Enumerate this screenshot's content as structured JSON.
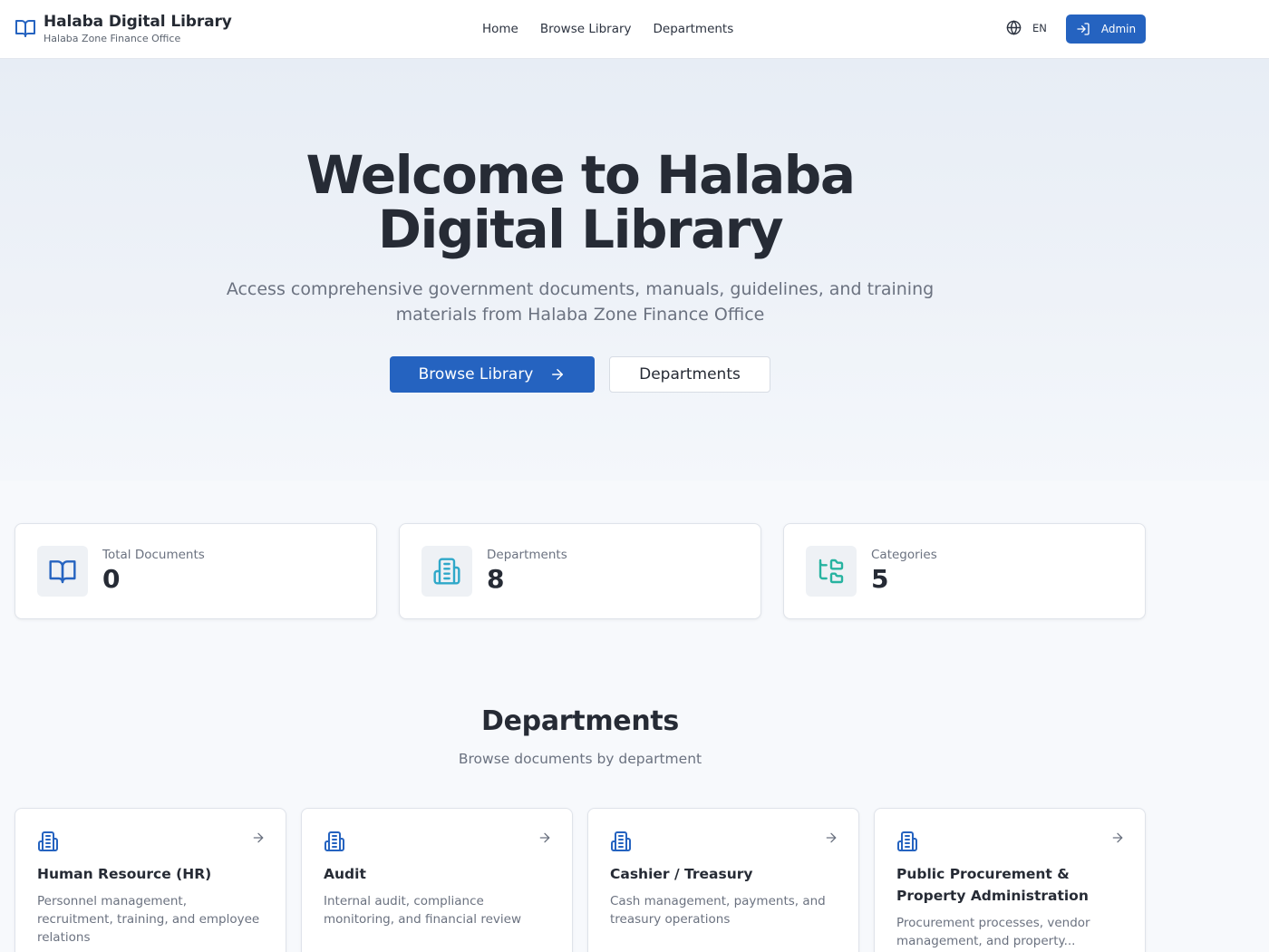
{
  "header": {
    "title": "Halaba Digital Library",
    "subtitle": "Halaba Zone Finance Office",
    "logo_icon": "open-book-icon",
    "nav": [
      {
        "label": "Home"
      },
      {
        "label": "Browse Library"
      },
      {
        "label": "Departments"
      }
    ],
    "language": {
      "icon": "globe-icon",
      "label": "EN"
    },
    "admin_button": {
      "icon": "login-icon",
      "label": "Admin"
    }
  },
  "hero": {
    "title": "Welcome to Halaba Digital Library",
    "description": "Access comprehensive government documents, manuals, guidelines, and training materials from Halaba Zone Finance Office",
    "primary_button": {
      "label": "Browse Library",
      "icon": "arrow-right-icon"
    },
    "secondary_button": {
      "label": "Departments"
    }
  },
  "stats": [
    {
      "label": "Total Documents",
      "value": "0",
      "icon": "book-icon",
      "color": "#2563c0"
    },
    {
      "label": "Departments",
      "value": "8",
      "icon": "building-icon",
      "color": "#2fa8c9"
    },
    {
      "label": "Categories",
      "value": "5",
      "icon": "folder-tree-icon",
      "color": "#27b3a0"
    }
  ],
  "departments_section": {
    "title": "Departments",
    "subtitle": "Browse documents by department",
    "cards": [
      {
        "name": "Human Resource (HR)",
        "description": "Personnel management, recruitment, training, and employee relations"
      },
      {
        "name": "Audit",
        "description": "Internal audit, compliance monitoring, and financial review"
      },
      {
        "name": "Cashier / Treasury",
        "description": "Cash management, payments, and treasury operations"
      },
      {
        "name": "Public Procurement & Property Administration",
        "description": "Procurement processes, vendor management, and property..."
      }
    ]
  },
  "colors": {
    "accent": "#2563c0",
    "text": "#262b35",
    "muted": "#6b7280"
  }
}
